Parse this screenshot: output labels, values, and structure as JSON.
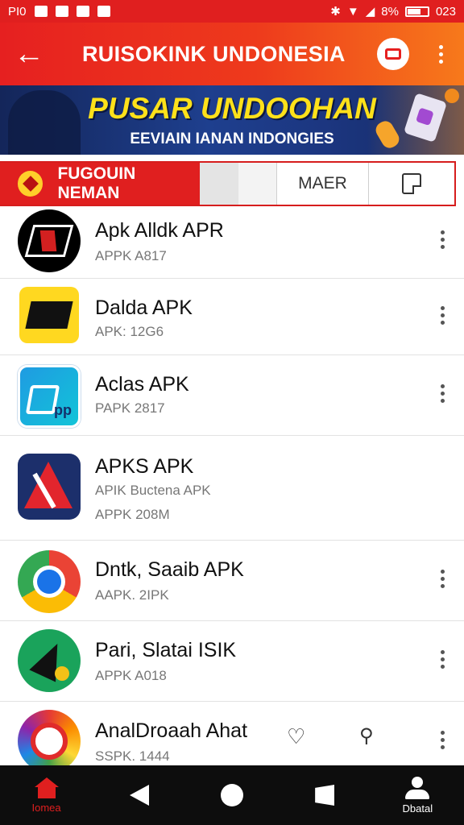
{
  "status_bar": {
    "left_text": "PI0",
    "battery": "8%",
    "time": "023"
  },
  "app_bar": {
    "back_icon": "←",
    "title": "RUISOKINK UNDONESIA"
  },
  "banner": {
    "title": "PUSAR UNDOOHAN",
    "subtitle": "EEVIAIN IANAN INDONGIES"
  },
  "tabs": {
    "main_label": "FUGOUIN NEMAN",
    "maer_label": "MAER"
  },
  "apps": [
    {
      "name": "Apk Alldk APR",
      "sub1": "APPK A817",
      "sub2": ""
    },
    {
      "name": "Dalda APK",
      "sub1": "APK: 12G6",
      "sub2": ""
    },
    {
      "name": "Aclas APK",
      "sub1": "PAPK 2817",
      "sub2": ""
    },
    {
      "name": "APKS APK",
      "sub1": "APIK Buctena APK",
      "sub2": "APPK 208M"
    },
    {
      "name": "Dntk, Saaib APK",
      "sub1": "AAPK. 2IPK",
      "sub2": ""
    },
    {
      "name": "Pari, Slatai ISIK",
      "sub1": "APPK A018",
      "sub2": ""
    },
    {
      "name": "AnalDroaah Ahat",
      "sub1": "SSPK. 1444",
      "sub2": ""
    }
  ],
  "bottom_nav": {
    "home_label": "Iomea",
    "profile_label": "Dbatal"
  },
  "colors": {
    "accent_red": "#e01f1f",
    "banner_yellow": "#ffe11a",
    "banner_blue": "#1e3f8e"
  }
}
